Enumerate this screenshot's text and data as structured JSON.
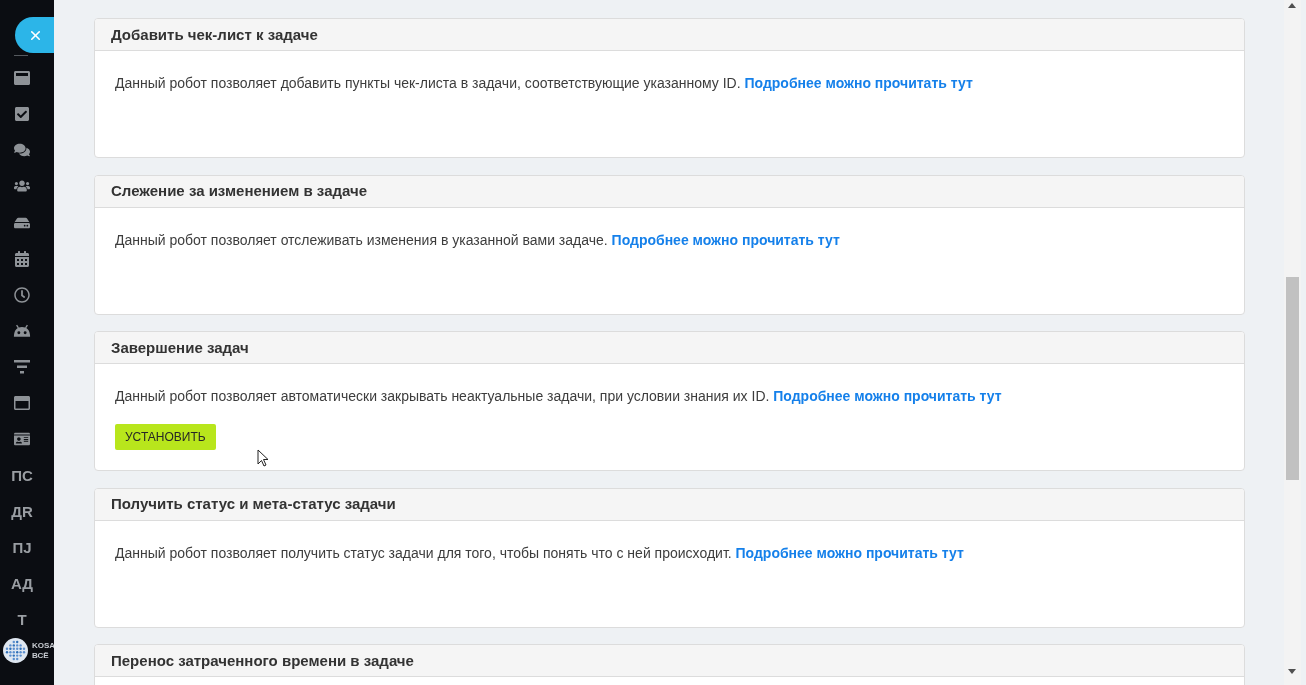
{
  "sidebar": {
    "labels": [
      "ПС",
      "ДR",
      "ПJ",
      "АД",
      "Т"
    ],
    "logo": {
      "lines": [
        "KOSA",
        "ВСЁ"
      ]
    }
  },
  "robots": [
    {
      "title": "Добавить чек-лист к задаче",
      "description": "Данный робот позволяет добавить пункты чек-листа в задачи, соответствующие указанному ID.",
      "link": "Подробнее можно прочитать тут"
    },
    {
      "title": "Слежение за изменением в задаче",
      "description": "Данный робот позволяет отслеживать изменения в указанной вами задаче.",
      "link": "Подробнее можно прочитать тут"
    },
    {
      "title": "Завершение задач",
      "description": "Данный робот позволяет автоматически закрывать неактуальные задачи, при условии знания их ID.",
      "link": "Подробнее можно прочитать тут",
      "button": "УСТАНОВИТЬ"
    },
    {
      "title": "Получить статус и мета-статус задачи",
      "description": "Данный робот позволяет получить статус задачи для того, чтобы понять что с ней происходит.",
      "link": "Подробнее можно прочитать тут"
    },
    {
      "title": "Перенос затраченного времени в задаче"
    }
  ]
}
